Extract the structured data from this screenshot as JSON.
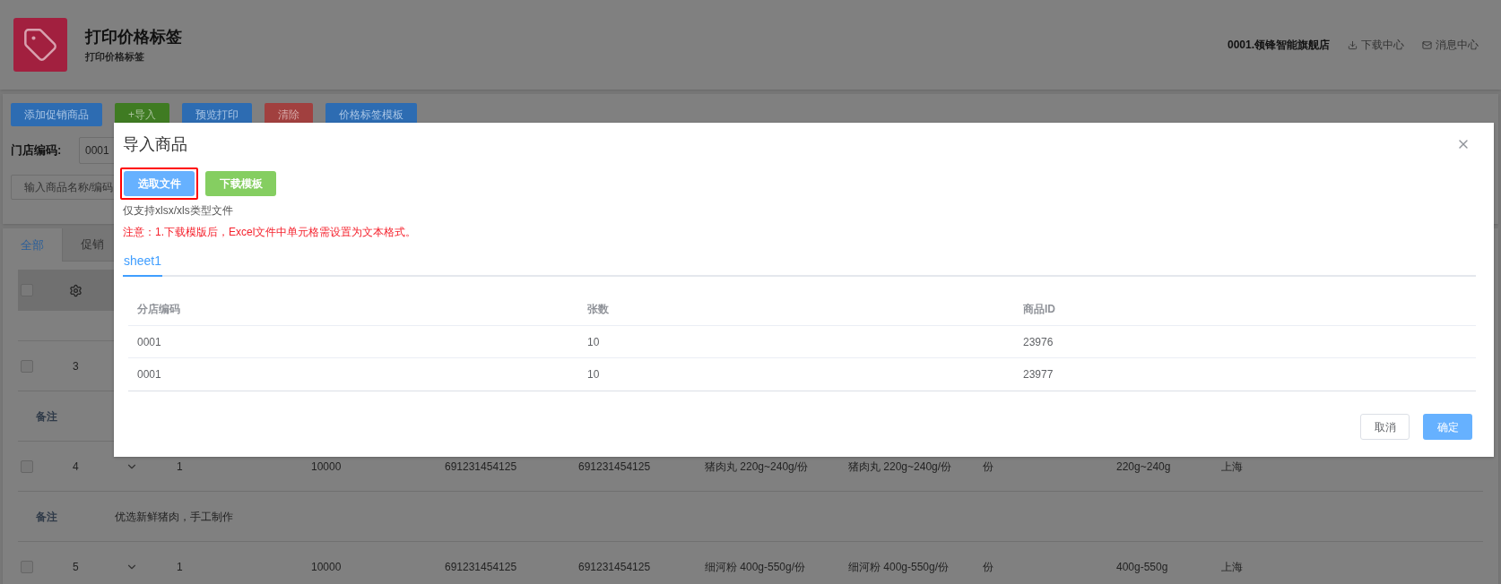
{
  "header": {
    "title": "打印价格标签",
    "subtitle": "打印价格标签",
    "store": "0001.领锋智能旗舰店",
    "links": [
      {
        "label": "下载中心",
        "kind": "download"
      },
      {
        "label": "消息中心",
        "kind": "mail"
      }
    ]
  },
  "toolbar": {
    "buttons": [
      {
        "label": "添加促销商品",
        "kind": "primary"
      },
      {
        "label": "+导入",
        "kind": "success"
      },
      {
        "label": "预览打印",
        "kind": "primary"
      },
      {
        "label": "清除",
        "kind": "danger"
      },
      {
        "label": "价格标签模板",
        "kind": "primary"
      }
    ]
  },
  "filters": {
    "store_code_label": "门店编码:",
    "store_code_value": "0001",
    "search_placeholder": "输入商品名称/编码"
  },
  "tabs": [
    {
      "label": "全部",
      "selected": true
    },
    {
      "label": "促销",
      "selected": false
    }
  ],
  "table": {
    "header_checked": false,
    "rows": [
      {
        "kind": "item",
        "checked": false,
        "number": "3",
        "cells": []
      },
      {
        "kind": "note",
        "label": "备注"
      },
      {
        "kind": "item",
        "checked": false,
        "number": "4",
        "cells": [
          "1",
          "10000",
          "691231454125",
          "691231454125",
          "猪肉丸 220g~240g/份",
          "猪肉丸 220g~240g/份",
          "份",
          "220g~240g",
          "上海"
        ]
      },
      {
        "kind": "note",
        "label": "备注",
        "text": "优选新鲜猪肉，手工制作"
      },
      {
        "kind": "item",
        "checked": false,
        "number": "5",
        "cells": [
          "1",
          "10000",
          "691231454125",
          "691231454125",
          "细河粉 400g-550g/份",
          "细河粉 400g-550g/份",
          "份",
          "400g-550g",
          "上海"
        ]
      }
    ]
  },
  "modal": {
    "title": "导入商品",
    "buttons": [
      {
        "label": "选取文件",
        "kind": "primary",
        "highlighted": true
      },
      {
        "label": "下载模板",
        "kind": "success",
        "highlighted": false
      }
    ],
    "hint": "仅支持xlsx/xls类型文件",
    "notice": "注意：1.下载模版后，Excel文件中单元格需设置为文本格式。",
    "tabs": [
      {
        "label": "sheet1",
        "selected": true
      }
    ],
    "table": {
      "columns": [
        "分店编码",
        "张数",
        "商品ID"
      ],
      "rows": [
        [
          "0001",
          "10",
          "23976"
        ],
        [
          "0001",
          "10",
          "23977"
        ]
      ]
    },
    "footer": [
      {
        "label": "取消",
        "kind": "default"
      },
      {
        "label": "确定",
        "kind": "primary"
      }
    ]
  }
}
